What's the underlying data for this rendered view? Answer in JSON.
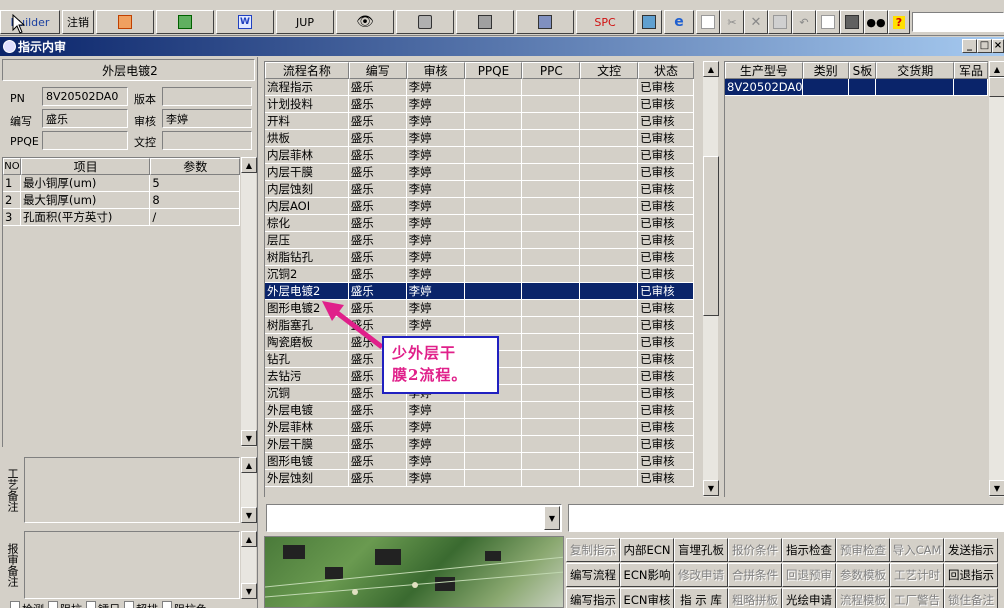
{
  "toolbar": {
    "builder_label": "Builder",
    "cancel_label": "注销",
    "jump_label": "JUP",
    "spc_label": "SPC"
  },
  "window": {
    "title": "指示内审"
  },
  "left_panel": {
    "header": "外层电镀2",
    "pn_label": "PN",
    "pn_value": "8V20502DA0",
    "version_label": "版本",
    "version_value": "",
    "editor_label": "编写",
    "editor_value": "盛乐",
    "reviewer_label": "审核",
    "reviewer_value": "李婷",
    "ppqe_label": "PPQE",
    "ppqe_value": "",
    "doc_label": "文控",
    "doc_value": ""
  },
  "params_grid": {
    "columns": [
      "NO",
      "项目",
      "参数"
    ],
    "rows": [
      {
        "no": "1",
        "item": "最小铜厚(um)",
        "value": "5"
      },
      {
        "no": "2",
        "item": "最大铜厚(um)",
        "value": "8"
      },
      {
        "no": "3",
        "item": "孔面积(平方英寸)",
        "value": "/"
      }
    ]
  },
  "remarks": {
    "process_label": "工艺备注",
    "report_label": "报审备注"
  },
  "flow_grid": {
    "columns": [
      "流程名称",
      "编写",
      "审核",
      "PPQE",
      "PPC",
      "文控",
      "状态"
    ],
    "rows": [
      {
        "name": "流程指示",
        "editor": "盛乐",
        "reviewer": "李婷",
        "status": "已审核"
      },
      {
        "name": "计划投料",
        "editor": "盛乐",
        "reviewer": "李婷",
        "status": "已审核"
      },
      {
        "name": "开料",
        "editor": "盛乐",
        "reviewer": "李婷",
        "status": "已审核"
      },
      {
        "name": "烘板",
        "editor": "盛乐",
        "reviewer": "李婷",
        "status": "已审核"
      },
      {
        "name": "内层菲林",
        "editor": "盛乐",
        "reviewer": "李婷",
        "status": "已审核"
      },
      {
        "name": "内层干膜",
        "editor": "盛乐",
        "reviewer": "李婷",
        "status": "已审核"
      },
      {
        "name": "内层蚀刻",
        "editor": "盛乐",
        "reviewer": "李婷",
        "status": "已审核"
      },
      {
        "name": "内层AOI",
        "editor": "盛乐",
        "reviewer": "李婷",
        "status": "已审核"
      },
      {
        "name": "棕化",
        "editor": "盛乐",
        "reviewer": "李婷",
        "status": "已审核"
      },
      {
        "name": "层压",
        "editor": "盛乐",
        "reviewer": "李婷",
        "status": "已审核"
      },
      {
        "name": "树脂钻孔",
        "editor": "盛乐",
        "reviewer": "李婷",
        "status": "已审核"
      },
      {
        "name": "沉铜2",
        "editor": "盛乐",
        "reviewer": "李婷",
        "status": "已审核"
      },
      {
        "name": "外层电镀2",
        "editor": "盛乐",
        "reviewer": "李婷",
        "status": "已审核"
      },
      {
        "name": "图形电镀2",
        "editor": "盛乐",
        "reviewer": "李婷",
        "status": "已审核"
      },
      {
        "name": "树脂塞孔",
        "editor": "盛乐",
        "reviewer": "李婷",
        "status": "已审核"
      },
      {
        "name": "陶瓷磨板",
        "editor": "盛乐",
        "reviewer": "李婷",
        "status": "已审核"
      },
      {
        "name": "钻孔",
        "editor": "盛乐",
        "reviewer": "李婷",
        "status": "已审核"
      },
      {
        "name": "去钻污",
        "editor": "盛乐",
        "reviewer": "李婷",
        "status": "已审核"
      },
      {
        "name": "沉铜",
        "editor": "盛乐",
        "reviewer": "李婷",
        "status": "已审核"
      },
      {
        "name": "外层电镀",
        "editor": "盛乐",
        "reviewer": "李婷",
        "status": "已审核"
      },
      {
        "name": "外层菲林",
        "editor": "盛乐",
        "reviewer": "李婷",
        "status": "已审核"
      },
      {
        "name": "外层干膜",
        "editor": "盛乐",
        "reviewer": "李婷",
        "status": "已审核"
      },
      {
        "name": "图形电镀",
        "editor": "盛乐",
        "reviewer": "李婷",
        "status": "已审核"
      },
      {
        "name": "外层蚀刻",
        "editor": "盛乐",
        "reviewer": "李婷",
        "status": "已审核"
      }
    ],
    "selected_index": 12
  },
  "product_grid": {
    "columns": [
      "生产型号",
      "类别",
      "S板",
      "交货期",
      "军品"
    ],
    "rows": [
      {
        "model": "8V20502DA0"
      }
    ]
  },
  "annotation": {
    "text_line1": "少外层干",
    "text_line2": "膜2流程。"
  },
  "checkboxes": {
    "labels": [
      "检测",
      "阻抗",
      "镭尺",
      "超排",
      "阻抗色"
    ]
  },
  "bottom_buttons": {
    "row1": [
      {
        "label": "复制指示",
        "enabled": false
      },
      {
        "label": "内部ECN",
        "enabled": true
      },
      {
        "label": "盲埋孔板",
        "enabled": true
      },
      {
        "label": "报价条件",
        "enabled": false
      },
      {
        "label": "指示检查",
        "enabled": true
      },
      {
        "label": "预审检查",
        "enabled": false
      },
      {
        "label": "导入CAM",
        "enabled": false
      },
      {
        "label": "发送指示",
        "enabled": true
      }
    ],
    "row2": [
      {
        "label": "编写流程",
        "enabled": true
      },
      {
        "label": "ECN影响",
        "enabled": true
      },
      {
        "label": "修改申请",
        "enabled": false
      },
      {
        "label": "合拼条件",
        "enabled": false
      },
      {
        "label": "回退预审",
        "enabled": false
      },
      {
        "label": "参数模板",
        "enabled": false
      },
      {
        "label": "工艺计时",
        "enabled": false
      },
      {
        "label": "回退指示",
        "enabled": true
      }
    ],
    "row3": [
      {
        "label": "编写指示",
        "enabled": true
      },
      {
        "label": "ECN审核",
        "enabled": true
      },
      {
        "label": "指 示 库",
        "enabled": true
      },
      {
        "label": "粗略拼板",
        "enabled": false
      },
      {
        "label": "光绘申请",
        "enabled": true
      },
      {
        "label": "流程模板",
        "enabled": false
      },
      {
        "label": "工厂警告",
        "enabled": false
      },
      {
        "label": "锁住备注",
        "enabled": false
      }
    ]
  },
  "colors": {
    "selection": "#0a246a",
    "callout_text": "#e0208a",
    "callout_border": "#2020c0"
  }
}
